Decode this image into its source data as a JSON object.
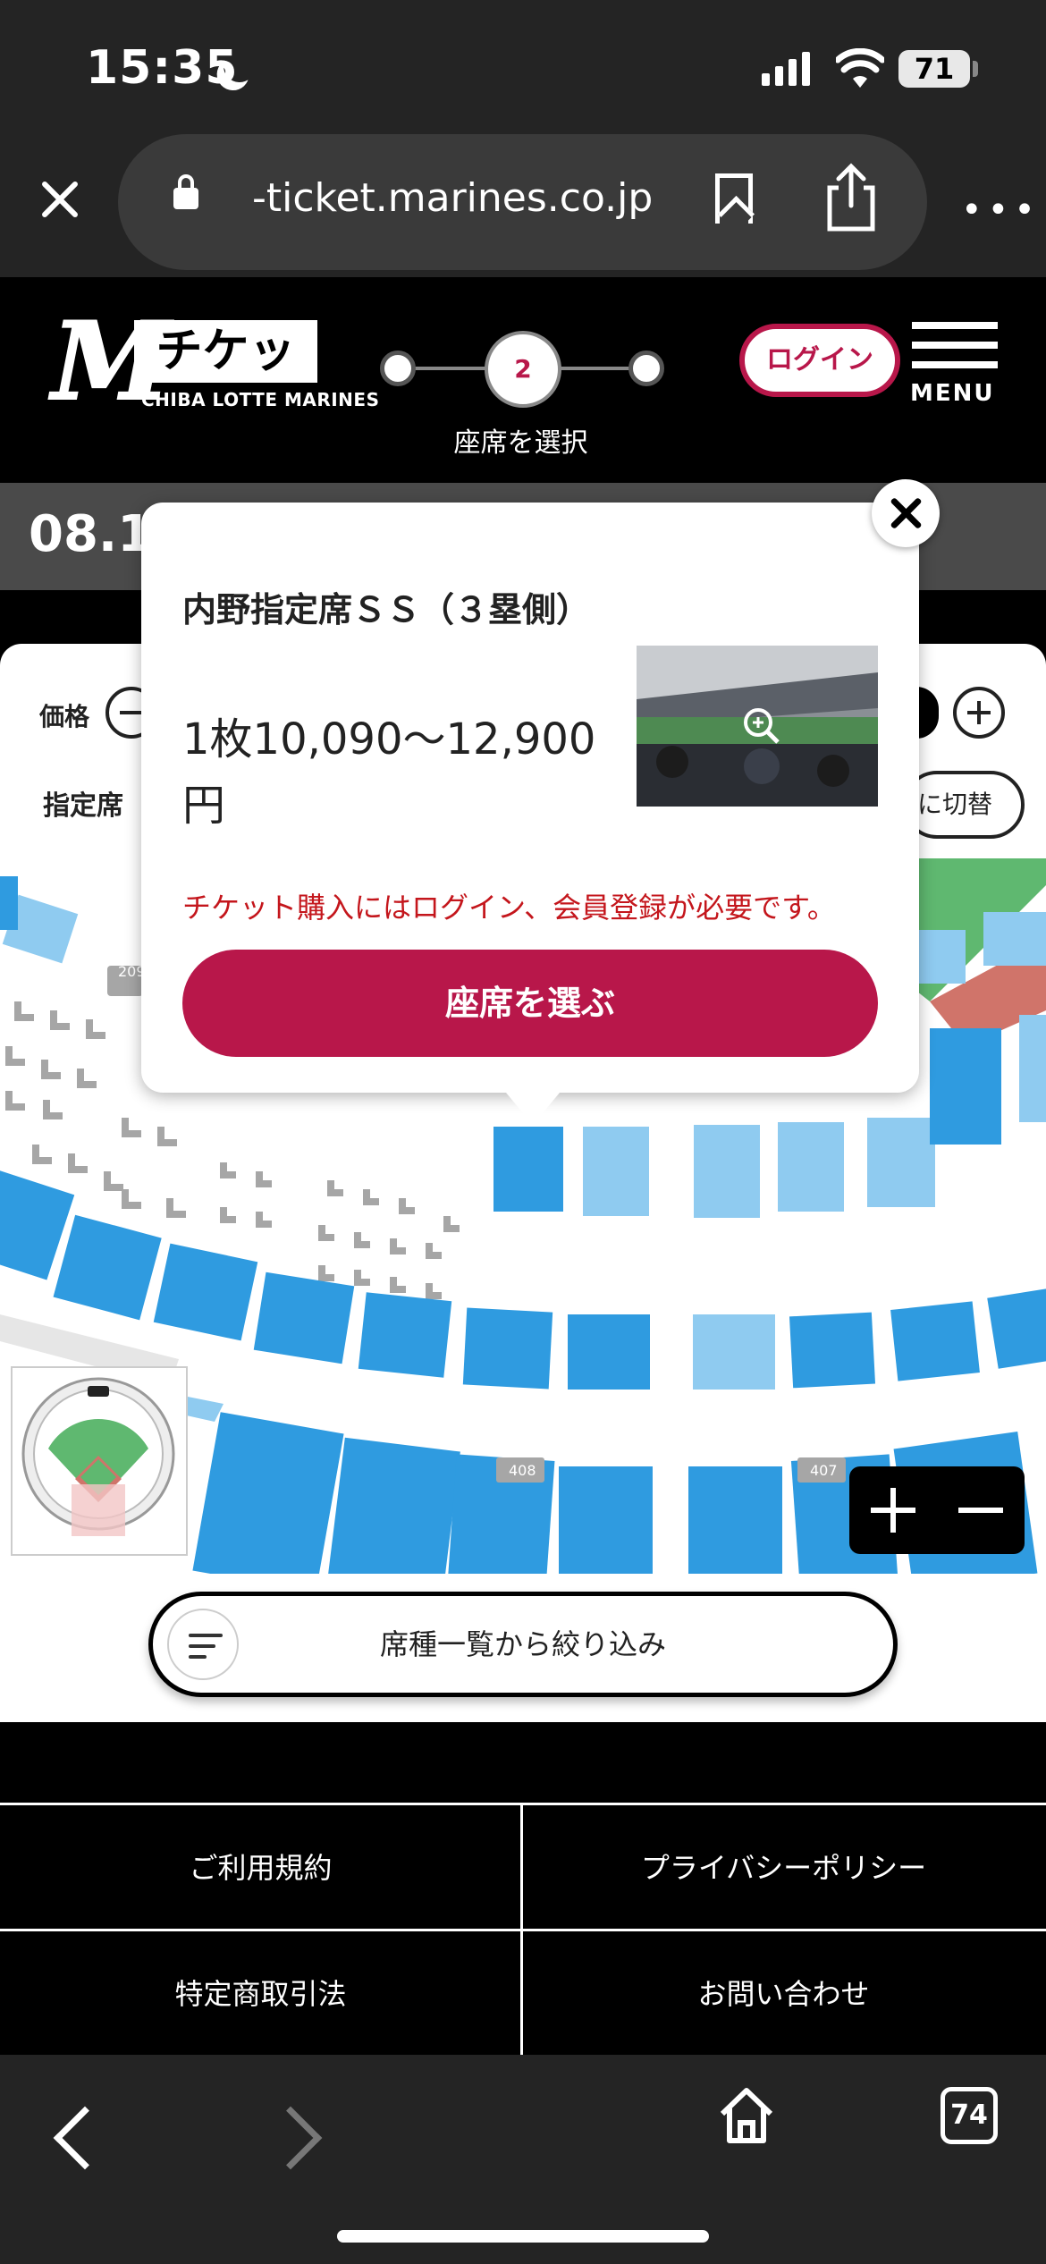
{
  "status_bar": {
    "time": "15:35",
    "battery": "71"
  },
  "browser": {
    "url": "-ticket.marines.co.jp",
    "tab_count": "74"
  },
  "header": {
    "logo_text": "チケット",
    "logo_sub": "CHIBA LOTTE MARINES",
    "step_number": "2",
    "step_label": "座席を選択",
    "login_label": "ログイン",
    "menu_label": "MENU"
  },
  "date_bar": {
    "date": "08.1"
  },
  "filters": {
    "price_label": "価格",
    "seat_label": "指定席",
    "switch_label": "に切替"
  },
  "popup": {
    "title": "内野指定席ＳＳ（３塁側）",
    "price": "1枚10,090〜12,900円",
    "note": "チケット購入にはログイン、会員登録が必要です。",
    "choose_label": "座席を選ぶ"
  },
  "map": {
    "section_labels": [
      "209",
      "408",
      "407"
    ],
    "colors": {
      "seat_dark": "#2f9be0",
      "seat_light": "#8fcbf0",
      "blocked": "#a6a6a6",
      "field": "#5fb870",
      "dirt": "#d0746a"
    }
  },
  "seat_filter_button": "席種一覧から絞り込み",
  "footer": {
    "terms": "ご利用規約",
    "privacy": "プライバシーポリシー",
    "commerce": "特定商取引法",
    "contact": "お問い合わせ"
  }
}
